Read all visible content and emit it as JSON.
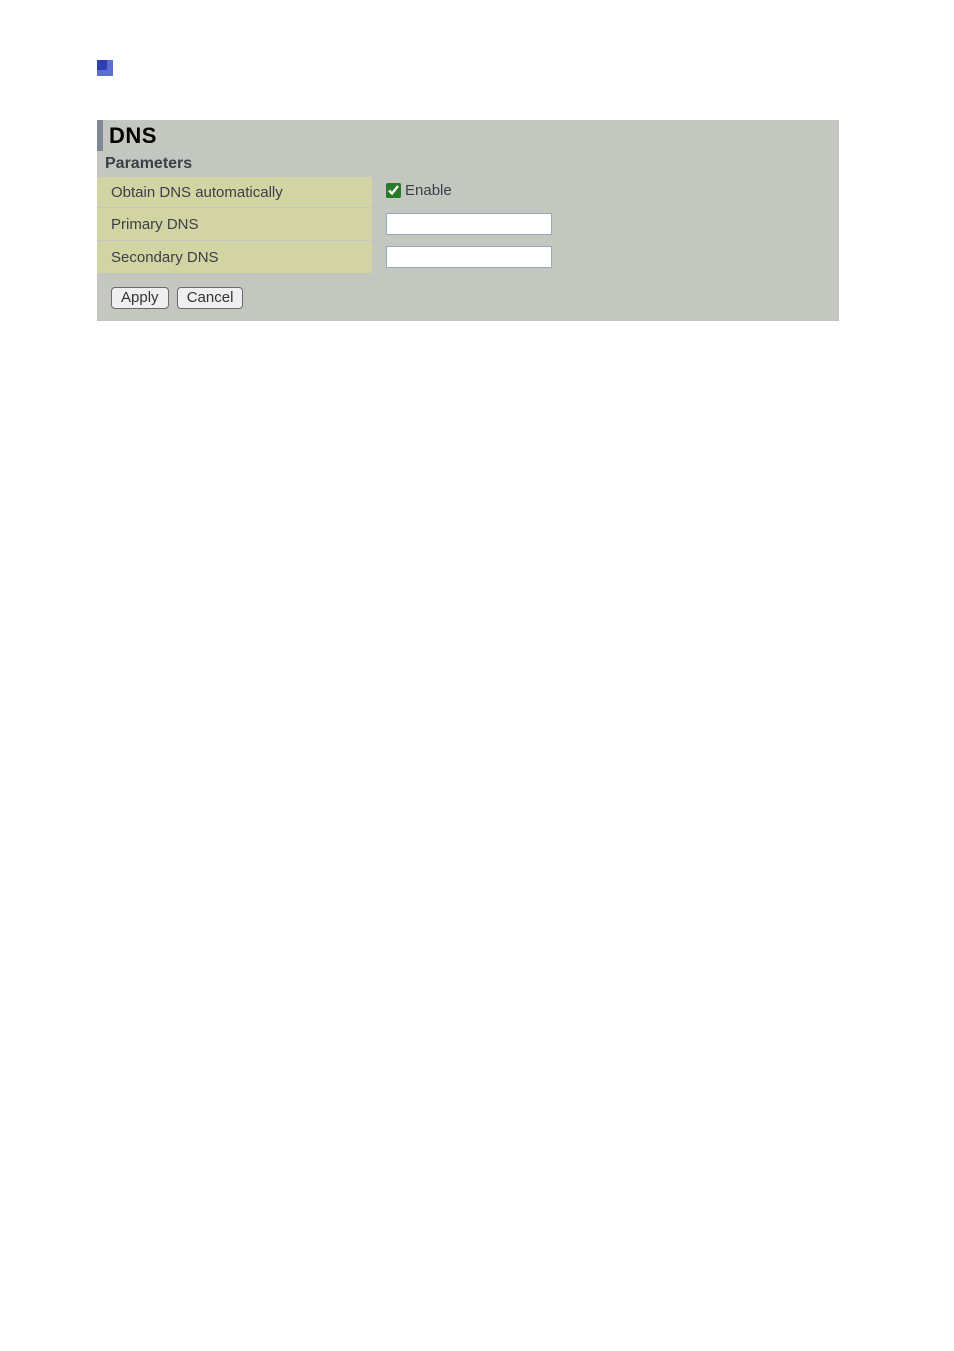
{
  "panel": {
    "title": "DNS",
    "subtitle": "Parameters"
  },
  "rows": {
    "auto": {
      "label": "Obtain DNS automatically",
      "checkbox_label": "Enable",
      "checked": true
    },
    "primary": {
      "label": "Primary DNS",
      "value": ""
    },
    "secondary": {
      "label": "Secondary DNS",
      "value": ""
    }
  },
  "buttons": {
    "apply": "Apply",
    "cancel": "Cancel"
  }
}
